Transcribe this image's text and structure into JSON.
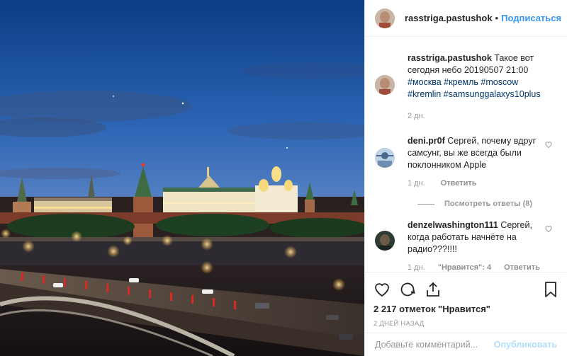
{
  "post": {
    "username": "rasstriga.pastushok",
    "follow_label": "Подписаться",
    "separator": "•"
  },
  "caption": {
    "username": "rasstriga.pastushok",
    "text_before": " Такое вот сегодня небо 20190507 21:00 ",
    "hashtags": [
      "#москва",
      "#кремль",
      "#moscow",
      "#kremlin",
      "#samsunggalaxys10plus"
    ],
    "age": "2 дн."
  },
  "comments": [
    {
      "username": "deni.pr0f",
      "text": " Сергей, почему вдруг самсунг, вы же всегда были поклонником Apple",
      "age": "1 дн.",
      "reply_label": "Ответить"
    },
    {
      "username": "denzelwashington111",
      "text": " Сергей, когда работать начнёте на радио???!!!!",
      "age": "1 дн.",
      "likes_label": "\"Нравится\": 4",
      "reply_label": "Ответить"
    }
  ],
  "view_replies": "Посмотреть ответы (8)",
  "likes": "2 217 отметок \"Нравится\"",
  "timestamp": "2 ДНЕЙ НАЗАД",
  "add_comment": {
    "placeholder": "Добавьте комментарий...",
    "publish_label": "Опубликовать"
  },
  "colors": {
    "accent": "#3897f0",
    "hashtag": "#003569",
    "muted": "#999999"
  },
  "icons": [
    "heart-icon",
    "comment-icon",
    "share-icon",
    "bookmark-icon"
  ]
}
